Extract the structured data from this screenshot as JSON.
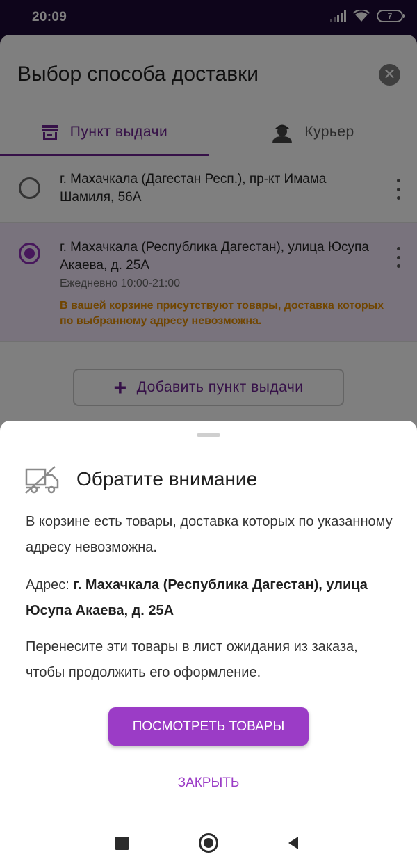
{
  "status_bar": {
    "time": "20:09",
    "battery": "7"
  },
  "dialog": {
    "title": "Выбор способа доставки",
    "tabs": [
      {
        "label": "Пункт выдачи",
        "icon": "store-icon",
        "selected": true
      },
      {
        "label": "Курьер",
        "icon": "courier-icon",
        "selected": false
      }
    ],
    "addresses": [
      {
        "text": "г. Махачкала (Дагестан Респ.), пр-кт Имама Шамиля, 56А",
        "selected": false
      },
      {
        "text": "г. Махачкала (Республика Дагестан), улица Юсупа Акаева, д. 25А",
        "hours": "Ежедневно 10:00-21:00",
        "warning": "В вашей корзине присутствуют товары, доставка которых по выбранному адресу невозможна.",
        "selected": true
      }
    ],
    "add_button": "Добавить пункт выдачи"
  },
  "sheet": {
    "title": "Обратите внимание",
    "text1": "В корзине есть товары, доставка которых по указанному адресу невозможна.",
    "address_label": "Адрес:",
    "address_value": "г. Махачкала (Республика Дагестан), улица Юсупа Акаева, д. 25А",
    "text3": "Перенесите эти товары в лист ожидания из заказа, чтобы продолжить его оформление.",
    "primary_button": "ПОСМОТРЕТЬ ТОВАРЫ",
    "secondary_button": "ЗАКРЫТЬ"
  },
  "colors": {
    "accent": "#9b3cc6",
    "tab_accent": "#6d2390",
    "warning": "#e08a00",
    "status_bar": "#1c0b36"
  }
}
